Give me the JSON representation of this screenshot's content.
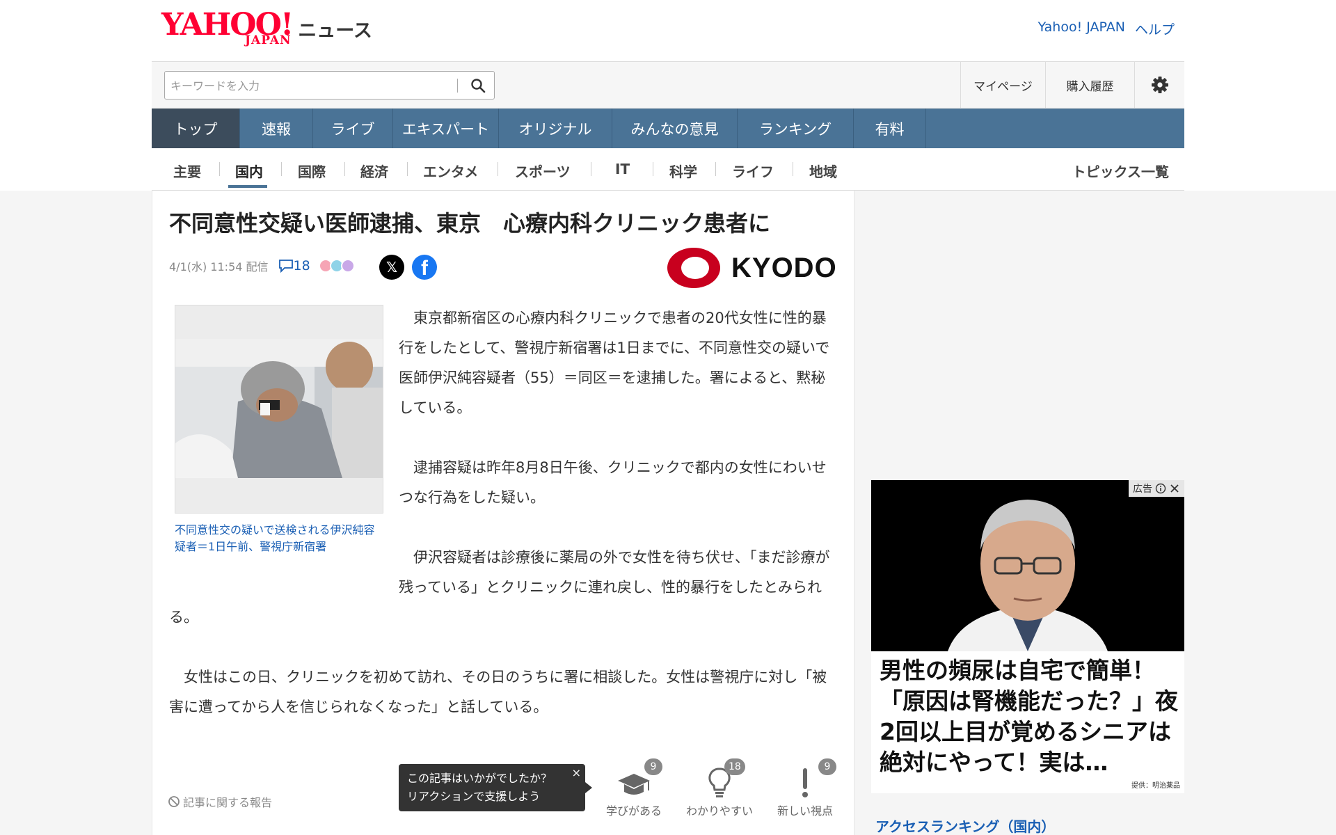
{
  "brand": {
    "logo_text": "YAHOO!",
    "logo_sub": "JAPAN",
    "section": "ニュース"
  },
  "top_links": [
    "Yahoo! JAPAN",
    "ヘルプ"
  ],
  "search": {
    "placeholder": "キーワードを入力",
    "value": ""
  },
  "utility": {
    "mypage": "マイページ",
    "history": "購入履歴",
    "settings_icon": "gear-icon"
  },
  "nav_main": [
    "トップ",
    "速報",
    "ライブ",
    "エキスパート",
    "オリジナル",
    "みんなの意見",
    "ランキング",
    "有料"
  ],
  "nav_main_active": "トップ",
  "nav_sub": [
    "主要",
    "国内",
    "国際",
    "経済",
    "エンタメ",
    "スポーツ",
    "IT",
    "科学",
    "ライフ",
    "地域"
  ],
  "nav_sub_active": "国内",
  "topics_link": "トピックス一覧",
  "article": {
    "headline": "不同意性交疑い医師逮捕、東京　心療内科クリニック患者に",
    "date": "4/1(水) 11:54 配信",
    "comment_count": "18",
    "provider": "KYODO",
    "photo_caption": "不同意性交の疑いで送検される伊沢純容疑者＝1日午前、警視庁新宿署",
    "paragraphs": [
      "東京都新宿区の心療内科クリニックで患者の20代女性に性的暴行をしたとして、警視庁新宿署は1日までに、不同意性交の疑いで医師伊沢純容疑者（55）＝同区＝を逮捕した。署によると、黙秘している。",
      "逮捕容疑は昨年8月8日午後、クリニックで都内の女性にわいせつな行為をした疑い。",
      "伊沢容疑者は診療後に薬局の外で女性を待ち伏せ、「まだ診療が残っている」とクリニックに連れ戻し、性的暴行をしたとみられる。",
      "女性はこの日、クリニックを初めて訪れ、その日のうちに署に相談した。女性は警視庁に対し「被害に遭ってから人を信じられなくなった」と話している。"
    ],
    "report_link": "記事に関する報告",
    "tooltip": {
      "line1": "この記事はいかがでしたか？",
      "line2": "リアクションで支援しよう",
      "close": "×"
    },
    "reactions": [
      {
        "label": "学びがある",
        "count": "9",
        "icon": "graduation-cap-icon"
      },
      {
        "label": "わかりやすい",
        "count": "18",
        "icon": "lightbulb-icon"
      },
      {
        "label": "新しい視点",
        "count": "9",
        "icon": "exclamation-icon"
      }
    ]
  },
  "ad": {
    "badge": "広告",
    "text": "男性の頻尿は自宅で簡単！「原因は腎機能だった？」夜2回以上目が覚めるシニアは絶対にやって！実は…",
    "source": "提供：明治薬品"
  },
  "ranking_title": "アクセスランキング（国内）",
  "colors": {
    "nav": "#4a7396",
    "nav_active": "#3c4c5c",
    "link": "#1a5fb4",
    "brand_red": "#ff0033",
    "kyodo_red": "#c8001e"
  }
}
